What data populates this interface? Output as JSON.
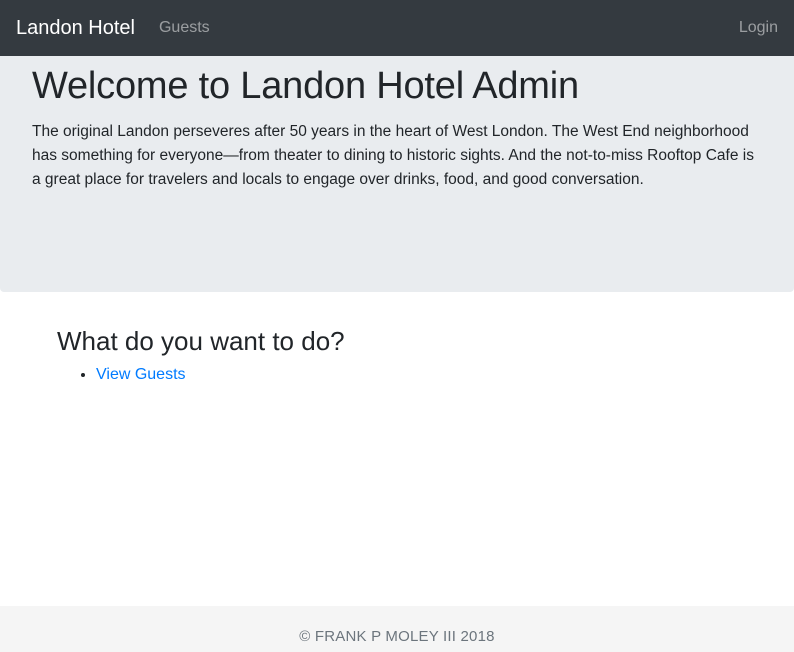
{
  "nav": {
    "brand": "Landon Hotel",
    "links": [
      "Guests"
    ],
    "login": "Login"
  },
  "hero": {
    "title": "Welcome to Landon Hotel Admin",
    "description": "The original Landon perseveres after 50 years in the heart of West London. The West End neighborhood has something for everyone—from theater to dining to historic sights. And the not-to-miss Rooftop Cafe is a great place for travelers and locals to engage over drinks, food, and good conversation."
  },
  "main": {
    "heading": "What do you want to do?",
    "actions": [
      "View Guests"
    ]
  },
  "footer": {
    "copyright": "© FRANK P MOLEY III 2018"
  },
  "colors": {
    "navbar_bg": "#343a40",
    "hero_bg": "#e9ecef",
    "link": "#007bff",
    "footer_bg": "#f5f5f5"
  }
}
